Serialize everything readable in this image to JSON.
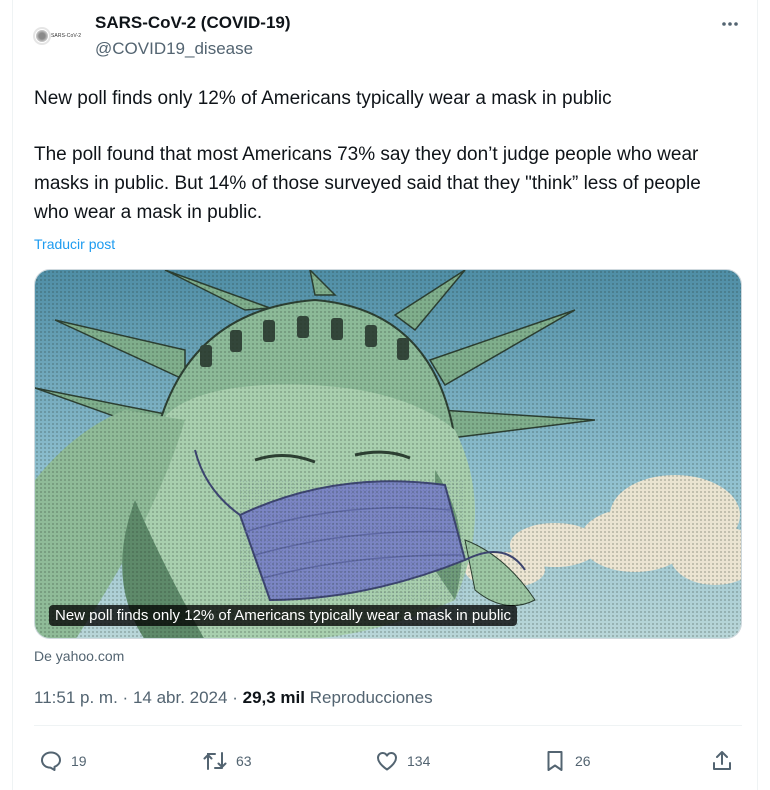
{
  "author": {
    "avatar_text": "SARS-CoV-2",
    "display_name": "SARS-CoV-2 (COVID-19)",
    "handle": "@COVID19_disease"
  },
  "tweet": {
    "line1": "New poll finds only 12% of Americans typically wear a mask in public",
    "line2": "The poll found that most Americans 73% say they don’t judge people who wear masks in public. But 14% of those surveyed said that they \"think” less of people who wear a mask in public.",
    "translate_label": "Traducir post"
  },
  "media": {
    "caption": "New poll finds only 12% of Americans typically wear a mask in public",
    "source": "De yahoo.com"
  },
  "meta": {
    "time": "11:51 p. m.",
    "separator": "·",
    "date": "14 abr. 2024",
    "views_count": "29,3 mil",
    "views_label": "Reproducciones"
  },
  "actions": {
    "replies": "19",
    "reposts": "63",
    "likes": "134",
    "bookmarks": "26"
  },
  "icons": [
    "more-icon",
    "reply-icon",
    "retweet-icon",
    "heart-icon",
    "bookmark-icon",
    "share-icon"
  ],
  "colors": {
    "link": "#1d9bf0",
    "secondary_text": "#536471",
    "primary_text": "#0f1419"
  }
}
